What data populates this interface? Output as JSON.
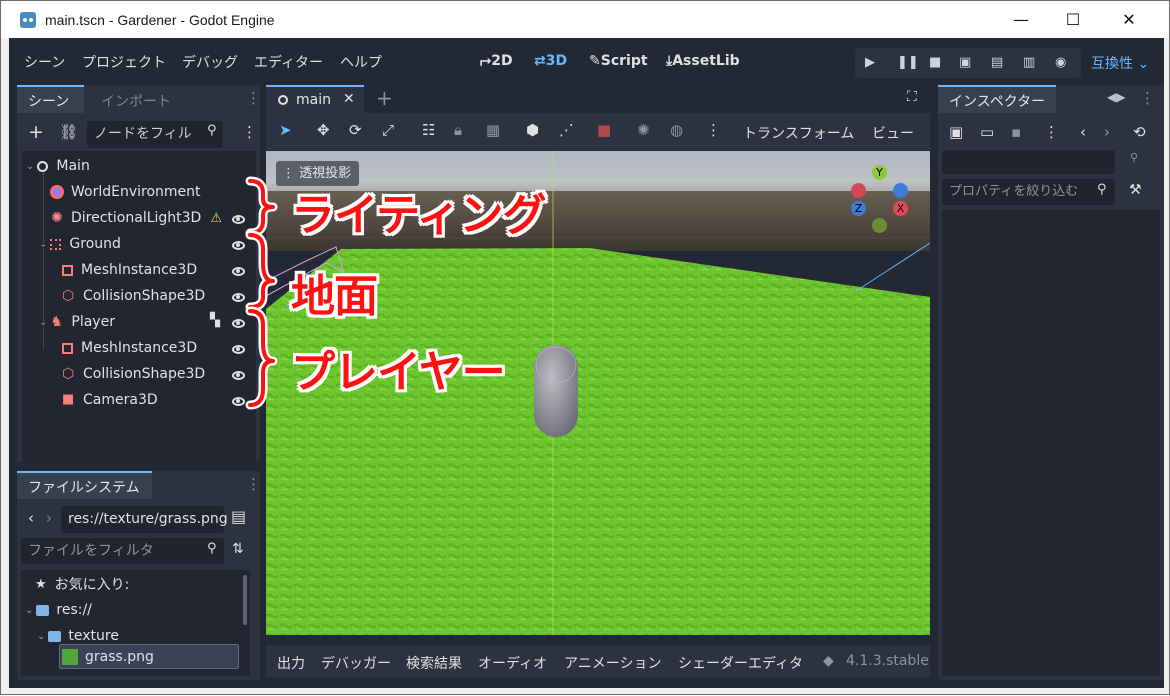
{
  "window": {
    "title": "main.tscn - Gardener - Godot Engine",
    "minimize": "—",
    "maximize": "☐",
    "close": "✕"
  },
  "menu": {
    "items": [
      "シーン",
      "プロジェクト",
      "デバッグ",
      "エディター",
      "ヘルプ"
    ]
  },
  "modes": {
    "m2d": "2D",
    "m3d": "3D",
    "script": "Script",
    "assetlib": "AssetLib",
    "active": "3D"
  },
  "compat": "互換性",
  "scene_dock": {
    "tabs": [
      "シーン",
      "インポート"
    ],
    "filter_placeholder": "ノードをフィル",
    "tree": [
      {
        "label": "Main",
        "icon": "node3d-icon"
      },
      {
        "label": "WorldEnvironment",
        "icon": "world-environment-icon"
      },
      {
        "label": "DirectionalLight3D",
        "icon": "directional-light-icon"
      },
      {
        "label": "Ground",
        "icon": "static-body-icon"
      },
      {
        "label": "MeshInstance3D",
        "icon": "mesh-instance-icon"
      },
      {
        "label": "CollisionShape3D",
        "icon": "collision-shape-icon"
      },
      {
        "label": "Player",
        "icon": "character-body-icon"
      },
      {
        "label": "MeshInstance3D",
        "icon": "mesh-instance-icon"
      },
      {
        "label": "CollisionShape3D",
        "icon": "collision-shape-icon"
      },
      {
        "label": "Camera3D",
        "icon": "camera-icon"
      }
    ]
  },
  "filesystem_dock": {
    "tab": "ファイルシステム",
    "path": "res://texture/grass.png",
    "filter_placeholder": "ファイルをフィルタ",
    "items": [
      "お気に入り:",
      "res://",
      "texture",
      "grass.png"
    ]
  },
  "editor": {
    "tab": "main",
    "toolbar_menus": [
      "トランスフォーム",
      "ビュー"
    ],
    "perspective_label": "透視投影",
    "gizmo_axes": {
      "y": "Y",
      "x": "X",
      "z": "Z"
    }
  },
  "inspector": {
    "tab": "インスペクター",
    "filter_placeholder": "プロパティを絞り込む"
  },
  "bottom_panel": {
    "items": [
      "出力",
      "デバッガー",
      "検索結果",
      "オーディオ",
      "アニメーション",
      "シェーダーエディタ"
    ],
    "version": "4.1.3.stable"
  },
  "annotations": {
    "lighting": "ライティング",
    "ground": "地面",
    "player": "プレイヤー"
  },
  "colors": {
    "accent": "#6cb6ff",
    "panel": "#2c3240",
    "background": "#222834",
    "annotation": "#ff1111",
    "grass": "#6bc72f"
  }
}
